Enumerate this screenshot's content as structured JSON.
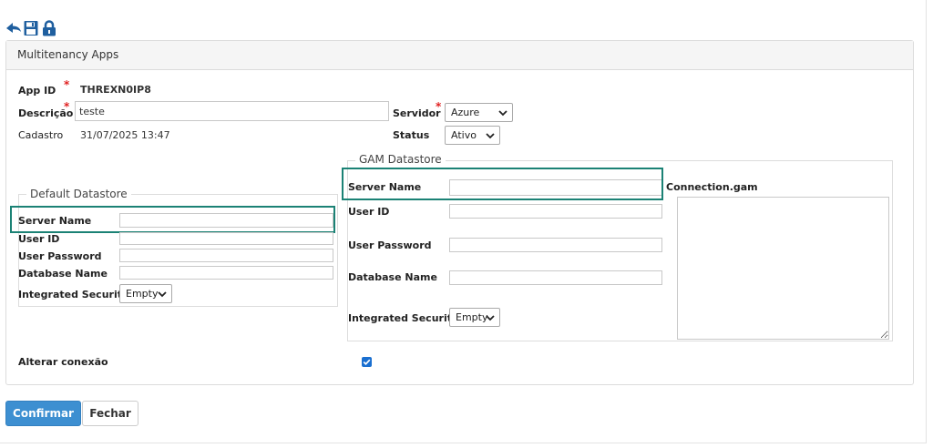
{
  "toolbar": {
    "icons": [
      "back-icon",
      "save-icon",
      "lock-icon"
    ],
    "accent": "#1f5f9f"
  },
  "panel": {
    "title": "Multitenancy Apps"
  },
  "form": {
    "app_id_label": "App ID",
    "app_id_value": "THREXN0IP8",
    "descricao_label": "Descrição",
    "descricao_value": "teste",
    "cadastro_label": "Cadastro",
    "cadastro_value": "31/07/2025 13:47",
    "servidor_label": "Servidor",
    "servidor_value": "Azure",
    "status_label": "Status",
    "status_value": "Ativo",
    "required_mark": "*"
  },
  "default_datastore": {
    "legend": "Default Datastore",
    "server_name_label": "Server Name",
    "server_name_value": "",
    "user_id_label": "User ID",
    "user_id_value": "",
    "user_password_label": "User Password",
    "user_password_value": "",
    "database_name_label": "Database Name",
    "database_name_value": "",
    "integrated_security_label": "Integrated Security",
    "integrated_security_value": "Empty"
  },
  "gam_datastore": {
    "legend": "GAM Datastore",
    "server_name_label": "Server Name",
    "server_name_value": "",
    "user_id_label": "User ID",
    "user_id_value": "",
    "user_password_label": "User Password",
    "user_password_value": "",
    "database_name_label": "Database Name",
    "database_name_value": "",
    "integrated_security_label": "Integrated Security",
    "integrated_security_value": "Empty",
    "connection_gam_label": "Connection.gam",
    "connection_gam_value": ""
  },
  "alterar_conexao": {
    "label": "Alterar conexão",
    "checked": true
  },
  "buttons": {
    "confirm": "Confirmar",
    "close": "Fechar"
  },
  "colors": {
    "highlight": "#1b8275",
    "primary_button": "#3d8fd1",
    "required": "#e02020"
  }
}
